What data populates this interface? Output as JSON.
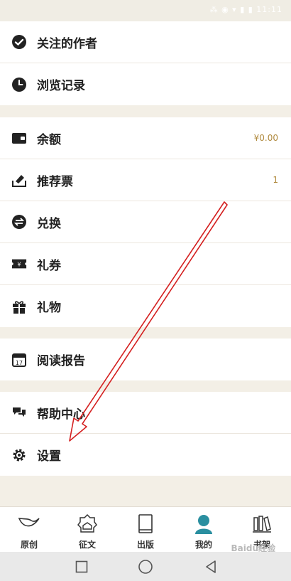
{
  "status_bar": {
    "text": "⁂ ◉ ▾ ▮ ▮ 11:11"
  },
  "groups": [
    {
      "items": [
        {
          "icon": "check-badge-icon",
          "label": "关注的作者"
        },
        {
          "icon": "clock-icon",
          "label": "浏览记录"
        }
      ]
    },
    {
      "items": [
        {
          "icon": "wallet-icon",
          "label": "余额",
          "value": "¥0.00"
        },
        {
          "icon": "ticket-tray-icon",
          "label": "推荐票",
          "value": "1"
        },
        {
          "icon": "exchange-icon",
          "label": "兑换"
        },
        {
          "icon": "coupon-icon",
          "label": "礼券"
        },
        {
          "icon": "gift-icon",
          "label": "礼物"
        }
      ]
    },
    {
      "items": [
        {
          "icon": "calendar-icon",
          "label": "阅读报告",
          "calendar_day": "17"
        }
      ]
    },
    {
      "items": [
        {
          "icon": "chat-bubbles-icon",
          "label": "帮助中心"
        },
        {
          "icon": "gear-icon",
          "label": "设置"
        }
      ]
    }
  ],
  "tabs": [
    {
      "icon": "bird-icon",
      "label": "原创"
    },
    {
      "icon": "badge-icon",
      "label": "征文"
    },
    {
      "icon": "book-icon",
      "label": "出版"
    },
    {
      "icon": "person-icon",
      "label": "我的",
      "active": true
    },
    {
      "icon": "bookshelf-icon",
      "label": "书架"
    }
  ],
  "watermark": "Baidu经验",
  "colors": {
    "accent": "#b08a3e",
    "active_tab": "#2a8fa0",
    "annotation_arrow": "#d42020"
  }
}
